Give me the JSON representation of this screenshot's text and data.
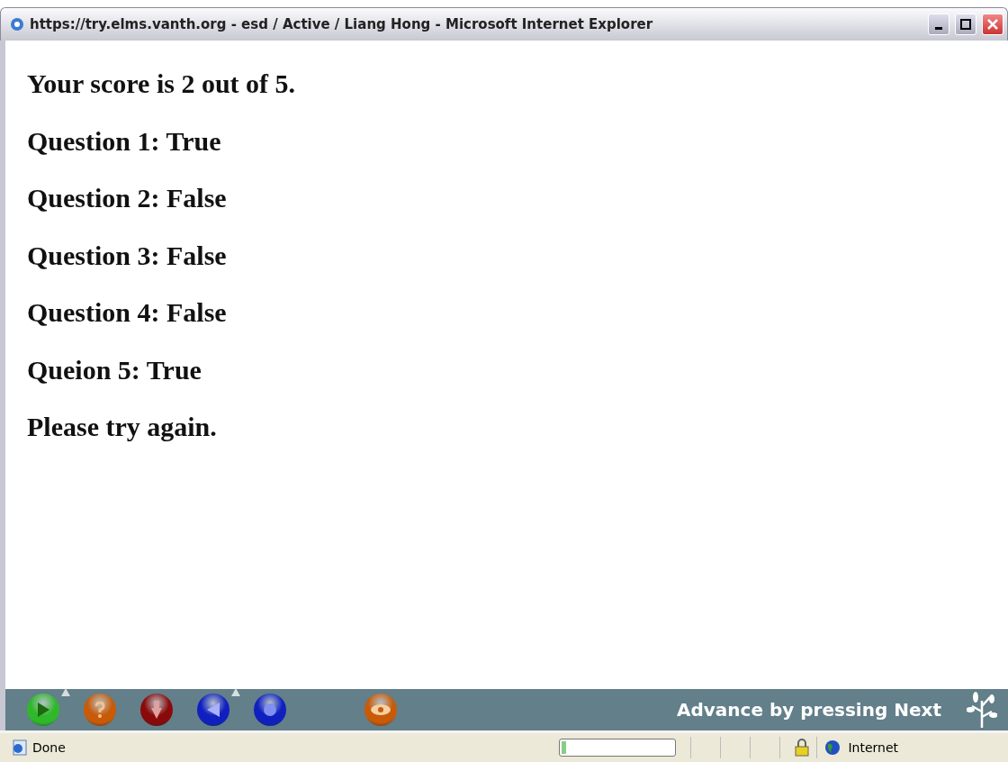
{
  "window": {
    "title": "https://try.elms.vanth.org - esd / Active / Liang Hong - Microsoft Internet Explorer"
  },
  "content": {
    "lines": [
      "Your score is 2 out of 5.",
      "Question 1: True",
      "Question 2: False",
      "Question 3: False",
      "Question 4: False",
      "Queion 5: True",
      "Please try again."
    ]
  },
  "toolbar": {
    "buttons": [
      {
        "kind": "play",
        "color": "#2fb82a",
        "flag": true
      },
      {
        "kind": "help",
        "color": "#c85a08",
        "flag": false
      },
      {
        "kind": "down",
        "color": "#8a0a0a",
        "flag": false
      },
      {
        "kind": "back",
        "color": "#1020c0",
        "flag": true
      },
      {
        "kind": "stop",
        "color": "#1020c0",
        "flag": false
      },
      {
        "kind": "gap"
      },
      {
        "kind": "view",
        "color": "#c85a08",
        "flag": false
      }
    ],
    "hint": "Advance by pressing Next"
  },
  "status_bar": {
    "text": "Done",
    "progress": {
      "level": 0.04
    },
    "zone": "Internet"
  }
}
